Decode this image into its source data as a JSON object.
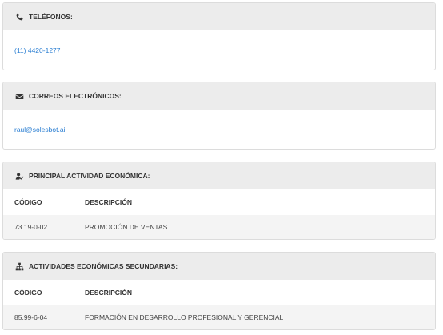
{
  "telefonos": {
    "title": "TELÉFONOS:",
    "icon": "phone-icon",
    "value": "(11) 4420-1277"
  },
  "correos": {
    "title": "CORREOS ELECTRÓNICOS:",
    "icon": "envelope-icon",
    "value": "raul@solesbot.ai"
  },
  "principal": {
    "title": "PRINCIPAL ACTIVIDAD ECONÓMICA:",
    "icon": "user-check-icon",
    "headers": {
      "code": "CÓDIGO",
      "desc": "DESCRIPCIÓN"
    },
    "rows": [
      {
        "code": "73.19-0-02",
        "desc": "PROMOCIÓN DE VENTAS"
      }
    ]
  },
  "secundarias": {
    "title": "ACTIVIDADES ECONÓMICAS SECUNDARIAS:",
    "icon": "sitemap-icon",
    "headers": {
      "code": "CÓDIGO",
      "desc": "DESCRIPCIÓN"
    },
    "rows": [
      {
        "code": "85.99-6-04",
        "desc": "FORMACIÓN EN DESARROLLO PROFESIONAL Y GERENCIAL"
      }
    ]
  },
  "colors": {
    "header_bg": "#ececec",
    "link": "#2a7ed2",
    "border": "#dcdcdc",
    "row_bg": "#f4f4f4"
  }
}
